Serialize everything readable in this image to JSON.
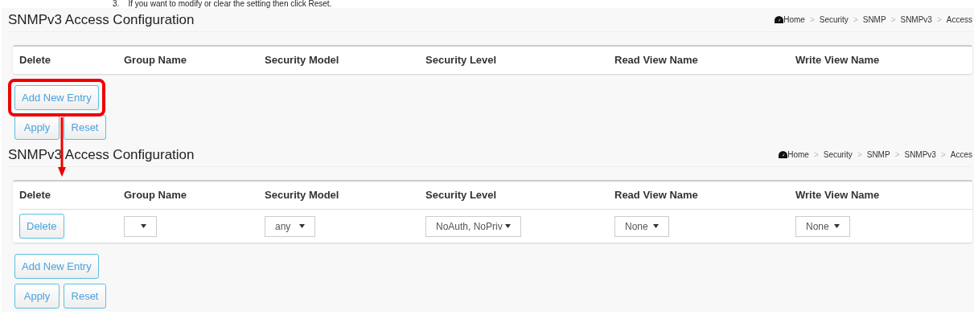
{
  "instruction": "3.    If you want to modify or clear the setting then click Reset.",
  "panels": [
    {
      "title": "SNMPv3 Access Configuration",
      "breadcrumb": {
        "separator": ">",
        "items": [
          "Home",
          "Security",
          "SNMP",
          "SNMPv3",
          "Access"
        ]
      },
      "table": {
        "columns": [
          "Delete",
          "Group Name",
          "Security Model",
          "Security Level",
          "Read View Name",
          "Write View Name"
        ]
      },
      "add_button": "Add New Entry",
      "buttons": [
        "Apply",
        "Reset"
      ],
      "highlighted": true
    },
    {
      "title": "SNMPv3 Access Configuration",
      "breadcrumb": {
        "separator": ">",
        "items": [
          "Home",
          "Security",
          "SNMP",
          "SNMPv3",
          "Acces"
        ]
      },
      "table": {
        "columns": [
          "Delete",
          "Group Name",
          "Security Model",
          "Security Level",
          "Read View Name",
          "Write View Name"
        ],
        "rows": [
          {
            "delete": "Delete",
            "group_name": {},
            "security_model": {
              "value": "any"
            },
            "security_level": {
              "value": "NoAuth, NoPriv"
            },
            "read_view": {
              "value": "None"
            },
            "write_view": {
              "value": "None"
            }
          }
        ]
      },
      "add_button": "Add New Entry",
      "buttons": [
        "Apply",
        "Reset"
      ],
      "highlighted": false
    }
  ]
}
